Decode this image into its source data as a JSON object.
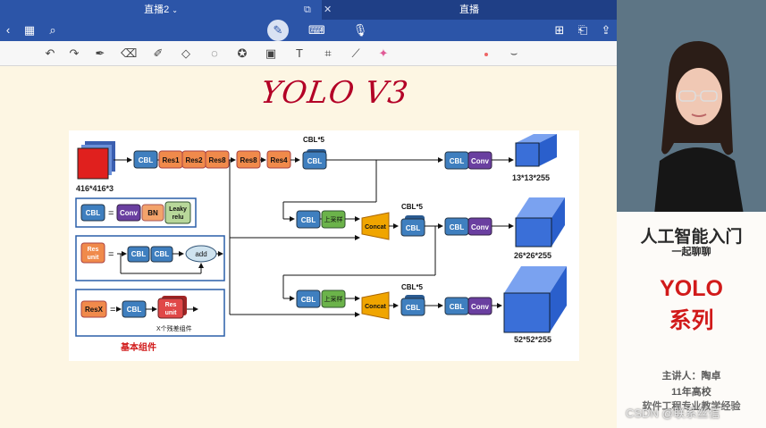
{
  "tabs": [
    {
      "label": "直播2",
      "active": true
    },
    {
      "label": "直播",
      "active": false
    }
  ],
  "tab_controls": {
    "window": "⧉",
    "close": "✕"
  },
  "navbar_icons": [
    "chevron-left-icon",
    "grid-icon",
    "search-icon",
    "pen-icon",
    "keyboard-icon",
    "mic-icon",
    "add-page-icon",
    "bookmark-icon",
    "share-icon"
  ],
  "toolbar_icons": [
    "undo-icon",
    "redo-icon",
    "pen-tool-icon",
    "eraser-icon",
    "highlighter-icon",
    "shapes-icon",
    "lasso-icon",
    "sticker-icon",
    "image-icon",
    "text-icon",
    "scan-icon",
    "ruler-icon",
    "laser-pointer-icon"
  ],
  "handwriting": "YOLO V3",
  "diagram": {
    "input_label": "416*416*3",
    "backbone": [
      "CBL",
      "Res1",
      "Res2",
      "Res8",
      "Res8",
      "Res4"
    ],
    "cbl5_label": "CBL*5",
    "conv_label": "Conv",
    "upsample_label": "上采样",
    "concat_label": "Concat",
    "outputs": [
      "13*13*255",
      "26*26*255",
      "52*52*255"
    ],
    "legend": {
      "cbl": "CBL",
      "equals": "=",
      "conv": "Conv",
      "bn": "BN",
      "leaky": [
        "Leaky",
        "relu"
      ],
      "res_unit": [
        "Res",
        "unit"
      ],
      "add": "add",
      "resx": "ResX",
      "note": "X个残差组件",
      "caption": "基本组件"
    }
  },
  "sidebar": {
    "title": "人工智能入门",
    "subtitle": "一起聊聊",
    "topic_line1": "YOLO",
    "topic_line2": "系列",
    "speaker": "主讲人：陶卓",
    "experience": "11年高校",
    "experience_detail": "软件工程专业教学经验"
  },
  "watermark": "CSDN @联系丝信",
  "colors": {
    "tabbar": "#1f3f86",
    "navbar": "#2c55a8",
    "cbl": "#3f7fbf",
    "res": "#f08a4b",
    "conv": "#6a3fa0",
    "bn": "#f3a36b",
    "leaky": "#b8d79a",
    "upsample": "#6bb34a",
    "concat": "#f0a500",
    "cube": "#3a6fd8",
    "handwriting": "#b30026",
    "accent_red": "#d11a1a"
  }
}
